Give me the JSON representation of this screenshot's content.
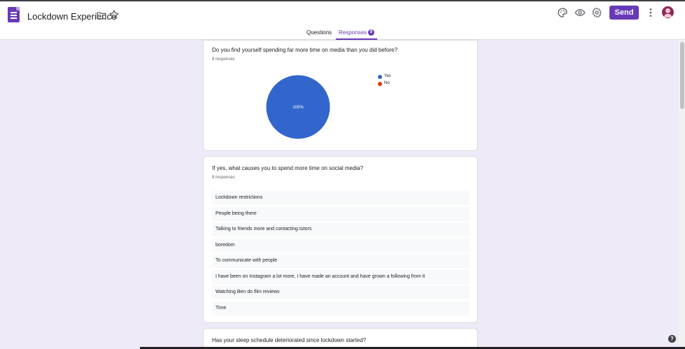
{
  "header": {
    "title": "Lockdown Experience",
    "send_label": "Send",
    "icons": [
      "forms-logo",
      "folder-icon",
      "star-icon",
      "palette-icon",
      "eye-icon",
      "gear-icon",
      "more-vert-icon",
      "avatar"
    ]
  },
  "tabs": {
    "questions": "Questions",
    "responses": "Responses",
    "responses_count": "8"
  },
  "colors": {
    "accent": "#673ab7",
    "yes": "#3366cc",
    "no": "#dc3912",
    "background": "#efeaf7"
  },
  "cards": [
    {
      "title": "Do you find yourself spending far more time on media than you did before?",
      "count": "8 responses",
      "chart_data": {
        "type": "pie",
        "slices": [
          {
            "label": "Yes",
            "value": 100,
            "color": "#3366cc"
          },
          {
            "label": "No",
            "value": 0,
            "color": "#dc3912"
          }
        ],
        "slice_label": "100%",
        "legend_position": "right"
      }
    },
    {
      "title": "If yes, what causes you to spend more time on social media?",
      "count": "8 responses",
      "responses": [
        "Lockdown restrictions",
        "People being there",
        "Talking to friends more and contacting tutors",
        "boredom",
        "To communicate with people",
        "I have been on Instagram a lot more, I have made an account and have grown a following from it",
        "Watching Ben do film reviews",
        "Time"
      ]
    },
    {
      "title": "Has your sleep schedule deteriorated since lockdown started?"
    }
  ],
  "help_label": "?"
}
